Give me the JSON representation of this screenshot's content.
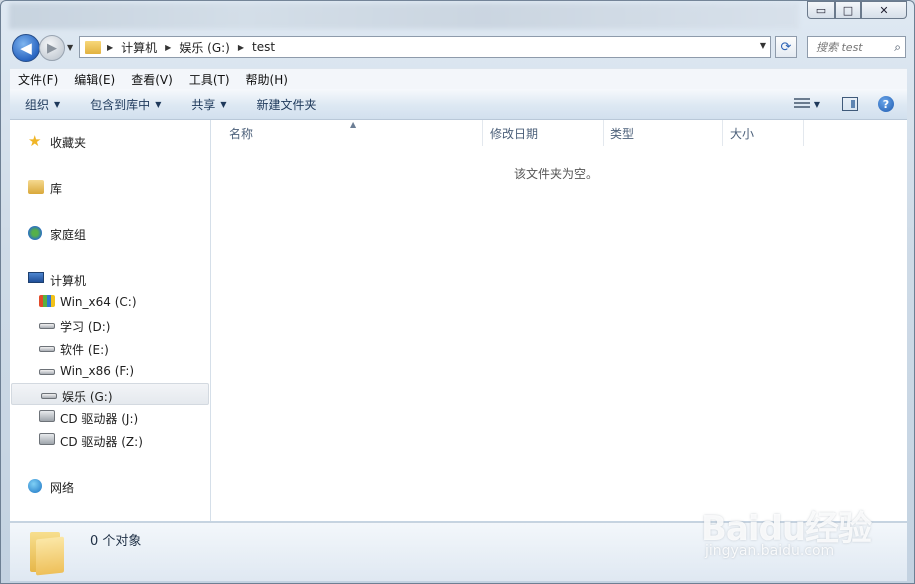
{
  "window": {
    "controls": {
      "minimize": "▭",
      "maximize": "□",
      "close": "✕"
    }
  },
  "navigation": {
    "back_icon": "◀",
    "forward_icon": "▶",
    "breadcrumb": [
      "计算机",
      "娱乐 (G:)",
      "test"
    ],
    "search_placeholder": "搜索 test"
  },
  "menubar": {
    "items": [
      "文件(F)",
      "编辑(E)",
      "查看(V)",
      "工具(T)",
      "帮助(H)"
    ]
  },
  "toolbar": {
    "items": [
      {
        "label": "组织",
        "dropdown": true
      },
      {
        "label": "包含到库中",
        "dropdown": true
      },
      {
        "label": "共享",
        "dropdown": true
      },
      {
        "label": "新建文件夹",
        "dropdown": false
      }
    ],
    "help_glyph": "?"
  },
  "sidebar": {
    "favorites": "收藏夹",
    "libraries": "库",
    "homegroup": "家庭组",
    "computer": "计算机",
    "drives": [
      {
        "label": "Win_x64 (C:)",
        "icon": "system-drive-icon"
      },
      {
        "label": "学习 (D:)",
        "icon": "drive-icon"
      },
      {
        "label": "软件 (E:)",
        "icon": "drive-icon"
      },
      {
        "label": "Win_x86 (F:)",
        "icon": "drive-icon"
      },
      {
        "label": "娱乐 (G:)",
        "icon": "drive-icon",
        "selected": true
      },
      {
        "label": "CD 驱动器 (J:)",
        "icon": "cd-drive-icon"
      },
      {
        "label": "CD 驱动器 (Z:)",
        "icon": "cd-drive-icon"
      }
    ],
    "network": "网络"
  },
  "content": {
    "columns": [
      "名称",
      "修改日期",
      "类型",
      "大小"
    ],
    "sort_glyph": "▲",
    "empty_message": "该文件夹为空。"
  },
  "status": {
    "count": "0 个对象"
  },
  "watermark": {
    "brand": "Baidu经验",
    "url": "jingyan.baidu.com"
  }
}
